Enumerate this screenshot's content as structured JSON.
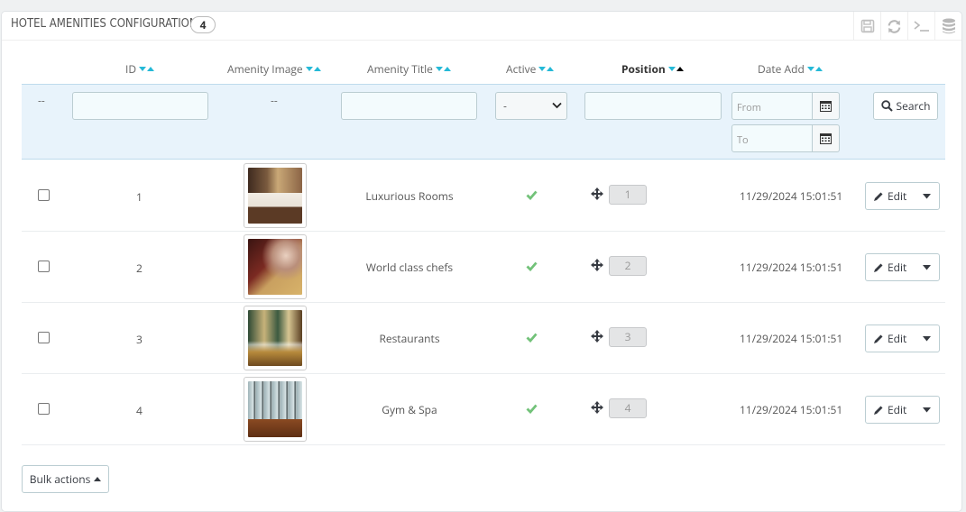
{
  "panel": {
    "title": "Hotel Amenities Configurations",
    "count": "4"
  },
  "toolbar": {
    "icons": [
      "save-icon",
      "refresh-icon",
      "terminal-icon",
      "database-icon"
    ]
  },
  "columns": {
    "id": "ID",
    "image": "Amenity Image",
    "title": "Amenity Title",
    "active": "Active",
    "position": "Position",
    "date_add": "Date Add"
  },
  "filters": {
    "id_placeholder": "--",
    "image_placeholder": "--",
    "active_selected": "-",
    "date_from_placeholder": "From",
    "date_to_placeholder": "To",
    "search_label": "Search"
  },
  "rows": [
    {
      "id": "1",
      "title": "Luxurious Rooms",
      "active": true,
      "position": "1",
      "date": "11/29/2024 15:01:51",
      "edit_label": "Edit",
      "image": "hotel-room-photo"
    },
    {
      "id": "2",
      "title": "World class chefs",
      "active": true,
      "position": "2",
      "date": "11/29/2024 15:01:51",
      "edit_label": "Edit",
      "image": "chef-cooking-photo"
    },
    {
      "id": "3",
      "title": "Restaurants",
      "active": true,
      "position": "3",
      "date": "11/29/2024 15:01:51",
      "edit_label": "Edit",
      "image": "restaurant-table-photo"
    },
    {
      "id": "4",
      "title": "Gym & Spa",
      "active": true,
      "position": "4",
      "date": "11/29/2024 15:01:51",
      "edit_label": "Edit",
      "image": "gym-equipment-photo"
    }
  ],
  "bulk_actions_label": "Bulk actions",
  "colors": {
    "accent": "#25b9d7",
    "check": "#72c279",
    "filter_bg": "#e8f3fb"
  }
}
